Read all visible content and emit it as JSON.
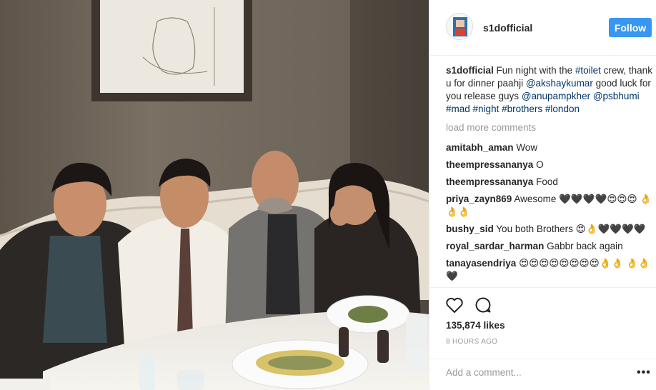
{
  "post": {
    "username": "s1dofficial",
    "follow_label": "Follow"
  },
  "caption": {
    "user": "s1dofficial",
    "text_1": "Fun night with the ",
    "tag_toilet": "#toilet",
    "text_2": " crew, thank u for dinner paahji ",
    "mention_akshay": "@akshaykumar",
    "text_3": " good luck for you release guys ",
    "mention_anupam": "@anupampkher",
    "mention_bhumi": "@psbhumi",
    "tag_mad": "#mad",
    "tag_night": "#night",
    "tag_brothers": "#brothers",
    "tag_london": "#london"
  },
  "load_more": "load more comments",
  "comments": [
    {
      "user": "amitabh_aman",
      "text": "Wow"
    },
    {
      "user": "theempressananya",
      "text": "O"
    },
    {
      "user": "theempressananya",
      "text": "Food"
    },
    {
      "user": "priya_zayn869",
      "text": "Awesome 🖤🖤🖤🖤😍😍😍 👌👌👌"
    },
    {
      "user": "bushy_sid",
      "text": "You both Brothers 😍👌🖤🖤🖤🖤"
    },
    {
      "user": "royal_sardar_harman",
      "text": "Gabbr back again"
    },
    {
      "user": "tanayasendriya",
      "text": "😍😍😍😍😍😍😍😍👌👌 👌👌🖤"
    }
  ],
  "likes": "135,874 likes",
  "time": "8 HOURS AGO",
  "add_comment_placeholder": "Add a comment...",
  "more_label": "•••",
  "icons": {
    "like": "heart-icon",
    "comment": "comment-bubble-icon",
    "options": "more-options-icon"
  },
  "colors": {
    "follow_button": "#3897f0",
    "link": "#003569",
    "muted": "#999999"
  }
}
